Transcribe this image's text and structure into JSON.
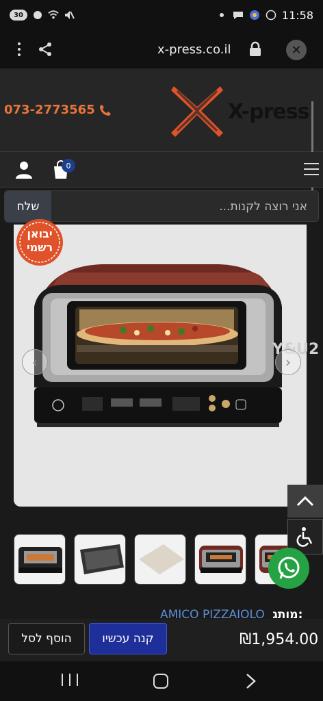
{
  "status_bar": {
    "battery": "30",
    "time": "11:58"
  },
  "browser": {
    "url": "x-press.co.il"
  },
  "header": {
    "phone": "073-2773565",
    "logo_text": "X-press"
  },
  "cart": {
    "count": "0"
  },
  "search": {
    "placeholder": "אני רוצה לקנות...",
    "button_label": "שלח"
  },
  "product": {
    "stamp_line1": "יבואן",
    "stamp_line2": "רשמי",
    "watermark": "Y&U2",
    "brand_label": "מותג:",
    "brand_value": "AMICO PIZZAIOLO",
    "price": "₪1,954.00",
    "thumbnails": [
      "oven-front",
      "baking-tray",
      "pizza-stone",
      "oven-front-2",
      "oven-angle"
    ]
  },
  "actions": {
    "buy_now": "קנה עכשיו",
    "add_to_cart": "הוסף לסל"
  },
  "colors": {
    "accent_orange": "#e8743b",
    "brand_blue": "#1e2f9a",
    "whatsapp_green": "#25a244"
  }
}
